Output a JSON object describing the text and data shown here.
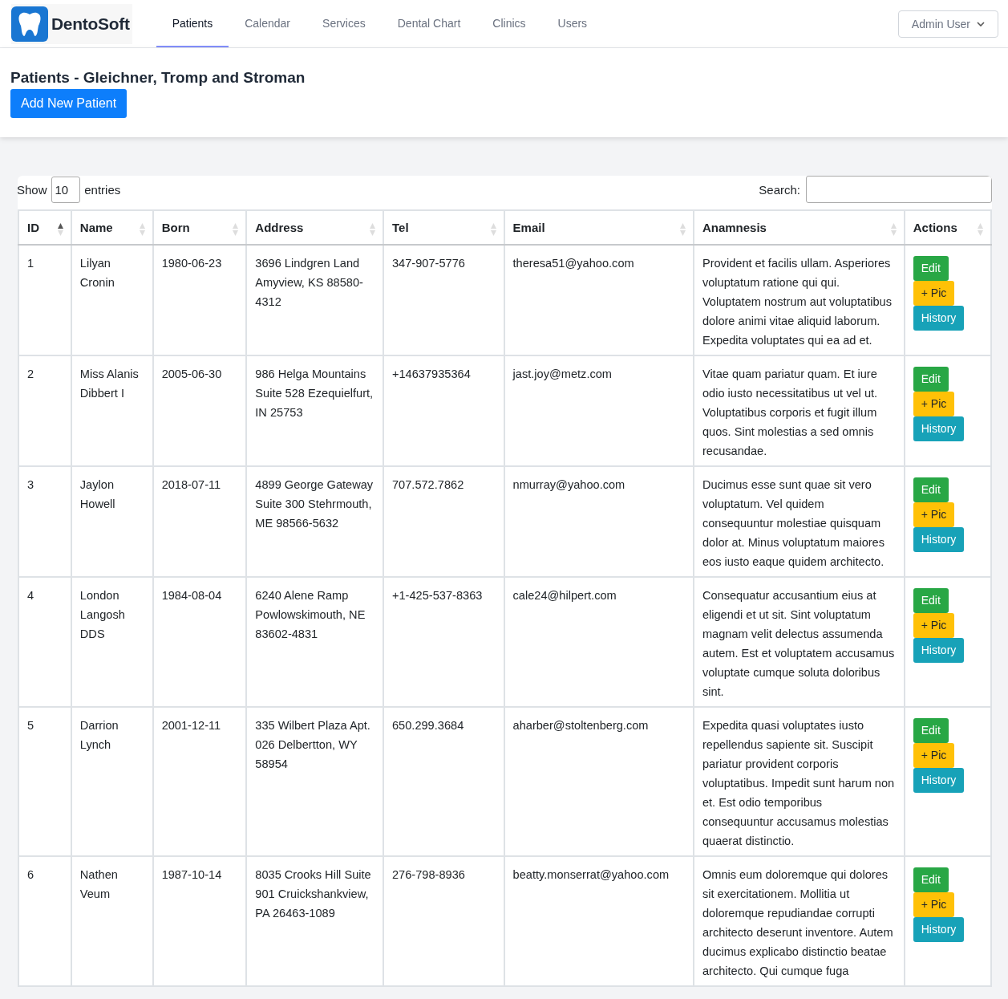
{
  "brand": {
    "name": "DentoSoft"
  },
  "nav": [
    {
      "label": "Patients",
      "selected": true
    },
    {
      "label": "Calendar",
      "selected": false
    },
    {
      "label": "Services",
      "selected": false
    },
    {
      "label": "Dental Chart",
      "selected": false
    },
    {
      "label": "Clinics",
      "selected": false
    },
    {
      "label": "Users",
      "selected": false
    }
  ],
  "user_menu": {
    "label": "Admin User"
  },
  "page": {
    "title": "Patients - Gleichner, Tromp and Stroman",
    "add_button": "Add New Patient"
  },
  "table_controls": {
    "show_label": "Show",
    "page_size": "10",
    "entries_label": "entries",
    "search_label": "Search:"
  },
  "table": {
    "columns": [
      {
        "label": "ID",
        "sorted": true
      },
      {
        "label": "Name",
        "sorted": false
      },
      {
        "label": "Born",
        "sorted": false
      },
      {
        "label": "Address",
        "sorted": false
      },
      {
        "label": "Tel",
        "sorted": false
      },
      {
        "label": "Email",
        "sorted": false
      },
      {
        "label": "Anamnesis",
        "sorted": false
      },
      {
        "label": "Actions",
        "sorted": false
      }
    ],
    "rows": [
      {
        "id": "1",
        "name": "Lilyan Cronin",
        "born": "1980-06-23",
        "address": "3696 Lindgren Land Amyview, KS 88580-4312",
        "tel": "347-907-5776",
        "email": "theresa51@yahoo.com",
        "anamnesis": "Provident et facilis ullam. Asperiores voluptatum ratione qui qui. Voluptatem nostrum aut voluptatibus dolore animi vitae aliquid laborum. Expedita voluptates qui ea ad et.",
        "actions": [
          {
            "label": "Edit",
            "kind": "edit"
          },
          {
            "label": "+ Pic",
            "kind": "pic"
          },
          {
            "label": "History",
            "kind": "history"
          }
        ]
      },
      {
        "id": "2",
        "name": "Miss Alanis Dibbert I",
        "born": "2005-06-30",
        "address": "986 Helga Mountains Suite 528 Ezequielfurt, IN 25753",
        "tel": "+14637935364",
        "email": "jast.joy@metz.com",
        "anamnesis": "Vitae quam pariatur quam. Et iure odio iusto necessitatibus ut vel ut. Voluptatibus corporis et fugit illum quos. Sint molestias a sed omnis recusandae.",
        "actions": [
          {
            "label": "Edit",
            "kind": "edit"
          },
          {
            "label": "+ Pic",
            "kind": "pic"
          },
          {
            "label": "History",
            "kind": "history"
          }
        ]
      },
      {
        "id": "3",
        "name": "Jaylon Howell",
        "born": "2018-07-11",
        "address": "4899 George Gateway Suite 300 Stehrmouth, ME 98566-5632",
        "tel": "707.572.7862",
        "email": "nmurray@yahoo.com",
        "anamnesis": "Ducimus esse sunt quae sit vero voluptatum. Vel quidem consequuntur molestiae quisquam dolor at. Minus voluptatum maiores eos iusto eaque quidem architecto.",
        "actions": [
          {
            "label": "Edit",
            "kind": "edit"
          },
          {
            "label": "+ Pic",
            "kind": "pic"
          },
          {
            "label": "History",
            "kind": "history"
          }
        ]
      },
      {
        "id": "4",
        "name": "London Langosh DDS",
        "born": "1984-08-04",
        "address": "6240 Alene Ramp Powlowskimouth, NE 83602-4831",
        "tel": "+1-425-537-8363",
        "email": "cale24@hilpert.com",
        "anamnesis": "Consequatur accusantium eius at eligendi et ut sit. Sint voluptatum magnam velit delectus assumenda autem. Est et voluptatem accusamus voluptate cumque soluta doloribus sint.",
        "actions": [
          {
            "label": "Edit",
            "kind": "edit"
          },
          {
            "label": "+ Pic",
            "kind": "pic"
          },
          {
            "label": "History",
            "kind": "history"
          }
        ]
      },
      {
        "id": "5",
        "name": "Darrion Lynch",
        "born": "2001-12-11",
        "address": "335 Wilbert Plaza Apt. 026 Delbertton, WY 58954",
        "tel": "650.299.3684",
        "email": "aharber@stoltenberg.com",
        "anamnesis": "Expedita quasi voluptates iusto repellendus sapiente sit. Suscipit pariatur provident corporis voluptatibus. Impedit sunt harum non et. Est odio temporibus consequuntur accusamus molestias quaerat distinctio.",
        "actions": [
          {
            "label": "Edit",
            "kind": "edit"
          },
          {
            "label": "+ Pic",
            "kind": "pic"
          },
          {
            "label": "History",
            "kind": "history"
          }
        ]
      },
      {
        "id": "6",
        "name": "Nathen Veum",
        "born": "1987-10-14",
        "address": "8035 Crooks Hill Suite 901 Cruickshankview, PA 26463-1089",
        "tel": "276-798-8936",
        "email": "beatty.monserrat@yahoo.com",
        "anamnesis": "Omnis eum doloremque qui dolores sit exercitationem. Mollitia ut doloremque repudiandae corrupti architecto deserunt inventore. Autem ducimus explicabo distinctio beatae architecto. Qui cumque fuga",
        "actions": [
          {
            "label": "Edit",
            "kind": "edit"
          },
          {
            "label": "+ Pic",
            "kind": "pic"
          },
          {
            "label": "History",
            "kind": "history"
          }
        ]
      }
    ]
  }
}
